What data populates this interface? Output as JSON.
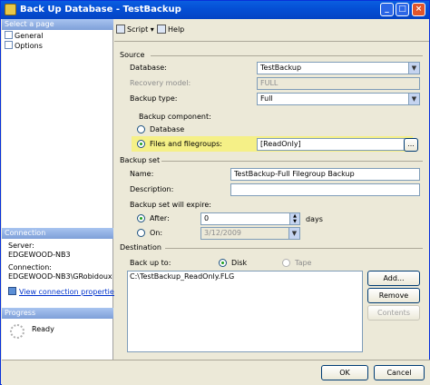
{
  "window": {
    "title": "Back Up Database - TestBackup"
  },
  "left_panel": {
    "select_page_header": "Select a page",
    "pages": [
      "General",
      "Options"
    ],
    "connection_header": "Connection",
    "server_label": "Server:",
    "server_value": "EDGEWOOD-NB3",
    "connection_label": "Connection:",
    "connection_value": "EDGEWOOD-NB3\\GRobidoux",
    "view_link": "View connection properties",
    "progress_header": "Progress",
    "progress_status": "Ready"
  },
  "toolbar": {
    "script_label": "Script",
    "help_label": "Help"
  },
  "source": {
    "section_label": "Source",
    "database_label": "Database:",
    "database_value": "TestBackup",
    "recovery_label": "Recovery model:",
    "recovery_value": "FULL",
    "backup_type_label": "Backup type:",
    "backup_type_value": "Full",
    "component_label": "Backup component:",
    "database_option": "Database",
    "files_option": "Files and filegroups:",
    "files_value": "[ReadOnly]",
    "browse_label": "..."
  },
  "backup_set": {
    "section_label": "Backup set",
    "name_label": "Name:",
    "name_value": "TestBackup-Full Filegroup Backup",
    "description_label": "Description:",
    "description_value": "",
    "expire_label": "Backup set will expire:",
    "after_label": "After:",
    "after_value": "0",
    "days_label": "days",
    "on_label": "On:",
    "on_value": "3/12/2009"
  },
  "destination": {
    "section_label": "Destination",
    "backup_to_label": "Back up to:",
    "disk_label": "Disk",
    "tape_label": "Tape",
    "paths": [
      "C:\\TestBackup_ReadOnly.FLG"
    ],
    "add_label": "Add...",
    "remove_label": "Remove",
    "contents_label": "Contents"
  },
  "footer": {
    "ok_label": "OK",
    "cancel_label": "Cancel"
  }
}
